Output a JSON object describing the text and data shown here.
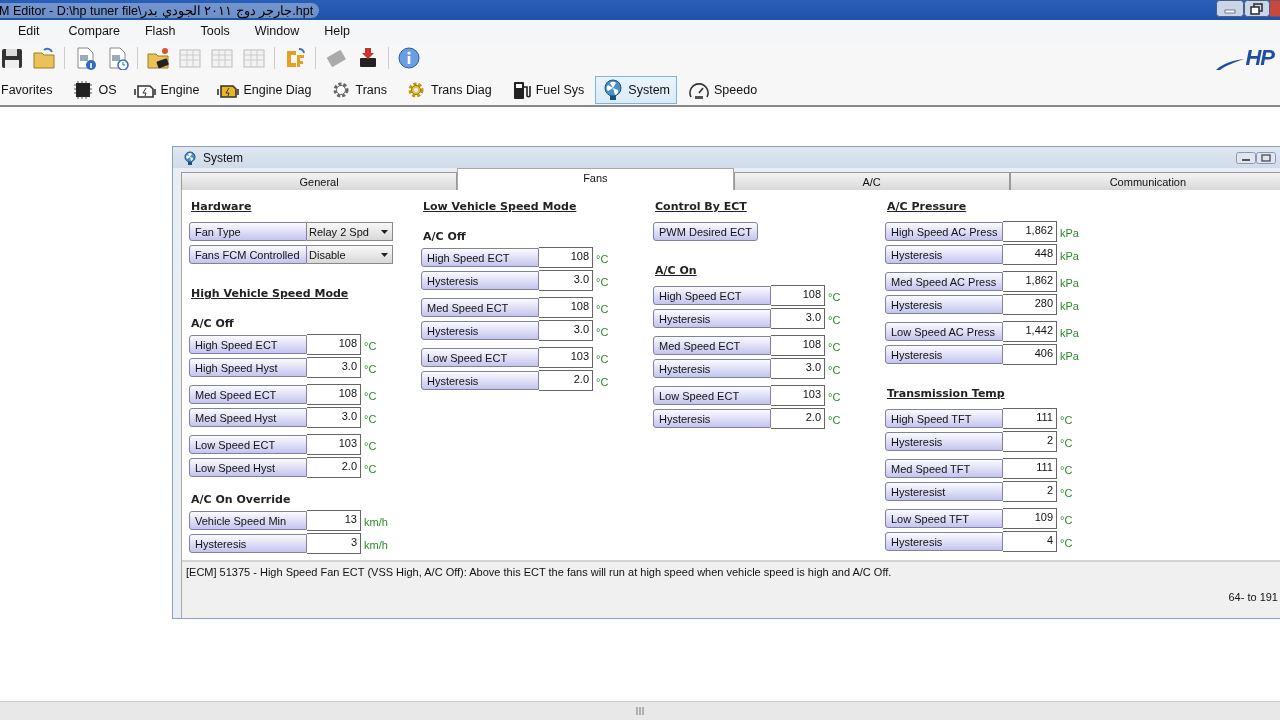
{
  "window": {
    "title": "M Editor - D:\\hp tuner file\\جارجر دوج ٢٠١١ الجودي بدر.hpt"
  },
  "menu": [
    "Edit",
    "Compare",
    "Flash",
    "Tools",
    "Window",
    "Help"
  ],
  "logo": {
    "text": "HP"
  },
  "nav": [
    {
      "label": "Favorites",
      "selected": false
    },
    {
      "label": "OS",
      "selected": false
    },
    {
      "label": "Engine",
      "selected": false
    },
    {
      "label": "Engine Diag",
      "selected": false
    },
    {
      "label": "Trans",
      "selected": false
    },
    {
      "label": "Trans Diag",
      "selected": false
    },
    {
      "label": "Fuel Sys",
      "selected": false
    },
    {
      "label": "System",
      "selected": true
    },
    {
      "label": "Speedo",
      "selected": false
    }
  ],
  "child_window": {
    "title": "System",
    "tabs": [
      {
        "label": "General",
        "selected": false
      },
      {
        "label": "Fans",
        "selected": true
      },
      {
        "label": "A/C",
        "selected": false
      },
      {
        "label": "Communication",
        "selected": false
      }
    ],
    "columns": [
      {
        "sections": [
          {
            "kind": "heading",
            "title": "Hardware",
            "groups": [
              [
                {
                  "kind": "dropdown",
                  "label": "Fan Type",
                  "value": "Relay 2 Spd"
                },
                {
                  "kind": "dropdown",
                  "label": "Fans FCM Controlled",
                  "value": "Disable"
                }
              ]
            ]
          },
          {
            "kind": "heading",
            "title": "High Vehicle Speed Mode"
          },
          {
            "kind": "subheading",
            "title": "A/C Off",
            "groups": [
              [
                {
                  "kind": "value",
                  "label": "High Speed ECT",
                  "value": "108",
                  "unit": "°C"
                },
                {
                  "kind": "value",
                  "label": "High Speed Hyst",
                  "value": "3.0",
                  "unit": "°C"
                }
              ],
              [
                {
                  "kind": "value",
                  "label": "Med Speed ECT",
                  "value": "108",
                  "unit": "°C"
                },
                {
                  "kind": "value",
                  "label": "Med Speed Hyst",
                  "value": "3.0",
                  "unit": "°C"
                }
              ],
              [
                {
                  "kind": "value",
                  "label": "Low Speed ECT",
                  "value": "103",
                  "unit": "°C"
                },
                {
                  "kind": "value",
                  "label": "Low Speed Hyst",
                  "value": "2.0",
                  "unit": "°C"
                }
              ]
            ]
          },
          {
            "kind": "subheading",
            "title": "A/C On Override",
            "groups": [
              [
                {
                  "kind": "value",
                  "label": "Vehicle Speed Min",
                  "value": "13",
                  "unit": "km/h"
                },
                {
                  "kind": "value",
                  "label": "Hysteresis",
                  "value": "3",
                  "unit": "km/h"
                }
              ]
            ]
          }
        ]
      },
      {
        "sections": [
          {
            "kind": "heading",
            "title": "Low Vehicle Speed Mode"
          },
          {
            "kind": "subheading",
            "title": "A/C Off",
            "groups": [
              [
                {
                  "kind": "value",
                  "label": "High Speed ECT",
                  "value": "108",
                  "unit": "°C"
                },
                {
                  "kind": "value",
                  "label": "Hysteresis",
                  "value": "3.0",
                  "unit": "°C"
                }
              ],
              [
                {
                  "kind": "value",
                  "label": "Med Speed ECT",
                  "value": "108",
                  "unit": "°C"
                },
                {
                  "kind": "value",
                  "label": "Hysteresis",
                  "value": "3.0",
                  "unit": "°C"
                }
              ],
              [
                {
                  "kind": "value",
                  "label": "Low Speed ECT",
                  "value": "103",
                  "unit": "°C"
                },
                {
                  "kind": "value",
                  "label": "Hysteresis",
                  "value": "2.0",
                  "unit": "°C"
                }
              ]
            ]
          }
        ]
      },
      {
        "sections": [
          {
            "kind": "heading",
            "title": "Control By ECT",
            "groups": [
              [
                {
                  "kind": "button",
                  "label": "PWM Desired ECT"
                }
              ]
            ]
          },
          {
            "kind": "heading",
            "title": "A/C On",
            "groups": [
              [
                {
                  "kind": "value",
                  "label": "High Speed ECT",
                  "value": "108",
                  "unit": "°C"
                },
                {
                  "kind": "value",
                  "label": "Hysteresis",
                  "value": "3.0",
                  "unit": "°C"
                }
              ],
              [
                {
                  "kind": "value",
                  "label": "Med Speed ECT",
                  "value": "108",
                  "unit": "°C"
                },
                {
                  "kind": "value",
                  "label": "Hysteresis",
                  "value": "3.0",
                  "unit": "°C"
                }
              ],
              [
                {
                  "kind": "value",
                  "label": "Low Speed ECT",
                  "value": "103",
                  "unit": "°C"
                },
                {
                  "kind": "value",
                  "label": "Hysteresis",
                  "value": "2.0",
                  "unit": "°C"
                }
              ]
            ]
          }
        ]
      },
      {
        "sections": [
          {
            "kind": "heading",
            "title": "A/C Pressure",
            "groups": [
              [
                {
                  "kind": "value",
                  "label": "High Speed AC Press",
                  "value": "1,862",
                  "unit": "kPa"
                },
                {
                  "kind": "value",
                  "label": "Hysteresis",
                  "value": "448",
                  "unit": "kPa"
                }
              ],
              [
                {
                  "kind": "value",
                  "label": "Med Speed AC Press",
                  "value": "1,862",
                  "unit": "kPa"
                },
                {
                  "kind": "value",
                  "label": "Hysteresis",
                  "value": "280",
                  "unit": "kPa"
                }
              ],
              [
                {
                  "kind": "value",
                  "label": "Low Speed AC Press",
                  "value": "1,442",
                  "unit": "kPa"
                },
                {
                  "kind": "value",
                  "label": "Hysteresis",
                  "value": "406",
                  "unit": "kPa"
                }
              ]
            ]
          },
          {
            "kind": "heading",
            "title": "Transmission Temp",
            "groups": [
              [
                {
                  "kind": "value",
                  "label": "High Speed TFT",
                  "value": "111",
                  "unit": "°C"
                },
                {
                  "kind": "value",
                  "label": "Hysteresis",
                  "value": "2",
                  "unit": "°C"
                }
              ],
              [
                {
                  "kind": "value",
                  "label": "Med Speed TFT",
                  "value": "111",
                  "unit": "°C"
                },
                {
                  "kind": "value",
                  "label": "Hysteresist",
                  "value": "2",
                  "unit": "°C"
                }
              ],
              [
                {
                  "kind": "value",
                  "label": "Low Speed TFT",
                  "value": "109",
                  "unit": "°C"
                },
                {
                  "kind": "value",
                  "label": "Hysteresis",
                  "value": "4",
                  "unit": "°C"
                }
              ]
            ]
          }
        ]
      }
    ],
    "description": "[ECM] 51375 - High Speed Fan ECT (VSS High, A/C Off): Above this ECT the fans will run at high speed when vehicle speed is high and A/C Off.",
    "range": "64- to 191"
  }
}
